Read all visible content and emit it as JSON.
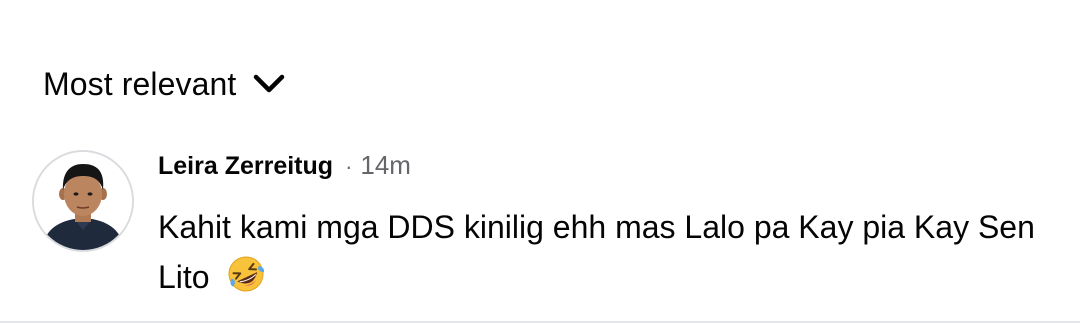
{
  "sort": {
    "label": "Most relevant",
    "icon": "chevron-down-icon"
  },
  "comment": {
    "author": "Leira Zerreitug",
    "separator": "·",
    "time": "14m",
    "text": "Kahit kami mga DDS kinilig ehh mas Lalo pa Kay pia Kay Sen Lito",
    "emoji": "rolling-on-floor-laughing-icon"
  },
  "colors": {
    "primary_text": "#050505",
    "secondary_text": "#65676b",
    "divider": "#e4e6eb"
  }
}
